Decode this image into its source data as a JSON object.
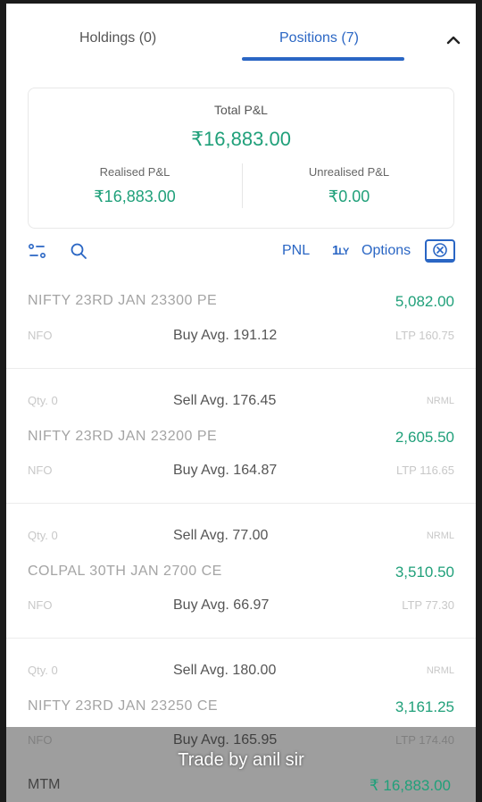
{
  "tabs": {
    "holdings": "Holdings (0)",
    "positions": "Positions (7)"
  },
  "summary": {
    "total_label": "Total P&L",
    "total_value": "₹16,883.00",
    "realised_label": "Realised P&L",
    "realised_value": "₹16,883.00",
    "unrealised_label": "Unrealised P&L",
    "unrealised_value": "₹0.00"
  },
  "toolbar": {
    "pnl": "PNL",
    "logo_main": "1",
    "logo_suffix": "LY",
    "options": "Options"
  },
  "positions": [
    {
      "qty": "",
      "sell_avg": "",
      "product": "",
      "symbol": "NIFTY 23RD JAN 23300 PE",
      "pnl": "5,082.00",
      "exchange": "NFO",
      "buy_avg": "Buy Avg. 191.12",
      "ltp": "LTP  160.75"
    },
    {
      "qty": "Qty. 0",
      "sell_avg": "Sell Avg. 176.45",
      "product": "NRML",
      "symbol": "NIFTY 23RD JAN 23200 PE",
      "pnl": "2,605.50",
      "exchange": "NFO",
      "buy_avg": "Buy Avg. 164.87",
      "ltp": "LTP  116.65"
    },
    {
      "qty": "Qty. 0",
      "sell_avg": "Sell Avg. 77.00",
      "product": "NRML",
      "symbol": "COLPAL 30TH JAN 2700 CE",
      "pnl": "3,510.50",
      "exchange": "NFO",
      "buy_avg": "Buy Avg. 66.97",
      "ltp": "LTP  77.30"
    },
    {
      "qty": "Qty. 0",
      "sell_avg": "Sell Avg. 180.00",
      "product": "NRML",
      "symbol": "NIFTY 23RD JAN 23250 CE",
      "pnl": "3,161.25",
      "exchange": "NFO",
      "buy_avg": "Buy Avg. 165.95",
      "ltp": "LTP  174.40"
    }
  ],
  "footer": {
    "mtm_label": "MTM",
    "mtm_value": "₹ 16,883.00"
  },
  "caption": "Trade by anil sir",
  "colors": {
    "accent": "#2a66c4",
    "profit": "#20a07a"
  },
  "icons": [
    "chevron-up-icon",
    "filter-icon",
    "search-icon",
    "options-chain-icon"
  ]
}
